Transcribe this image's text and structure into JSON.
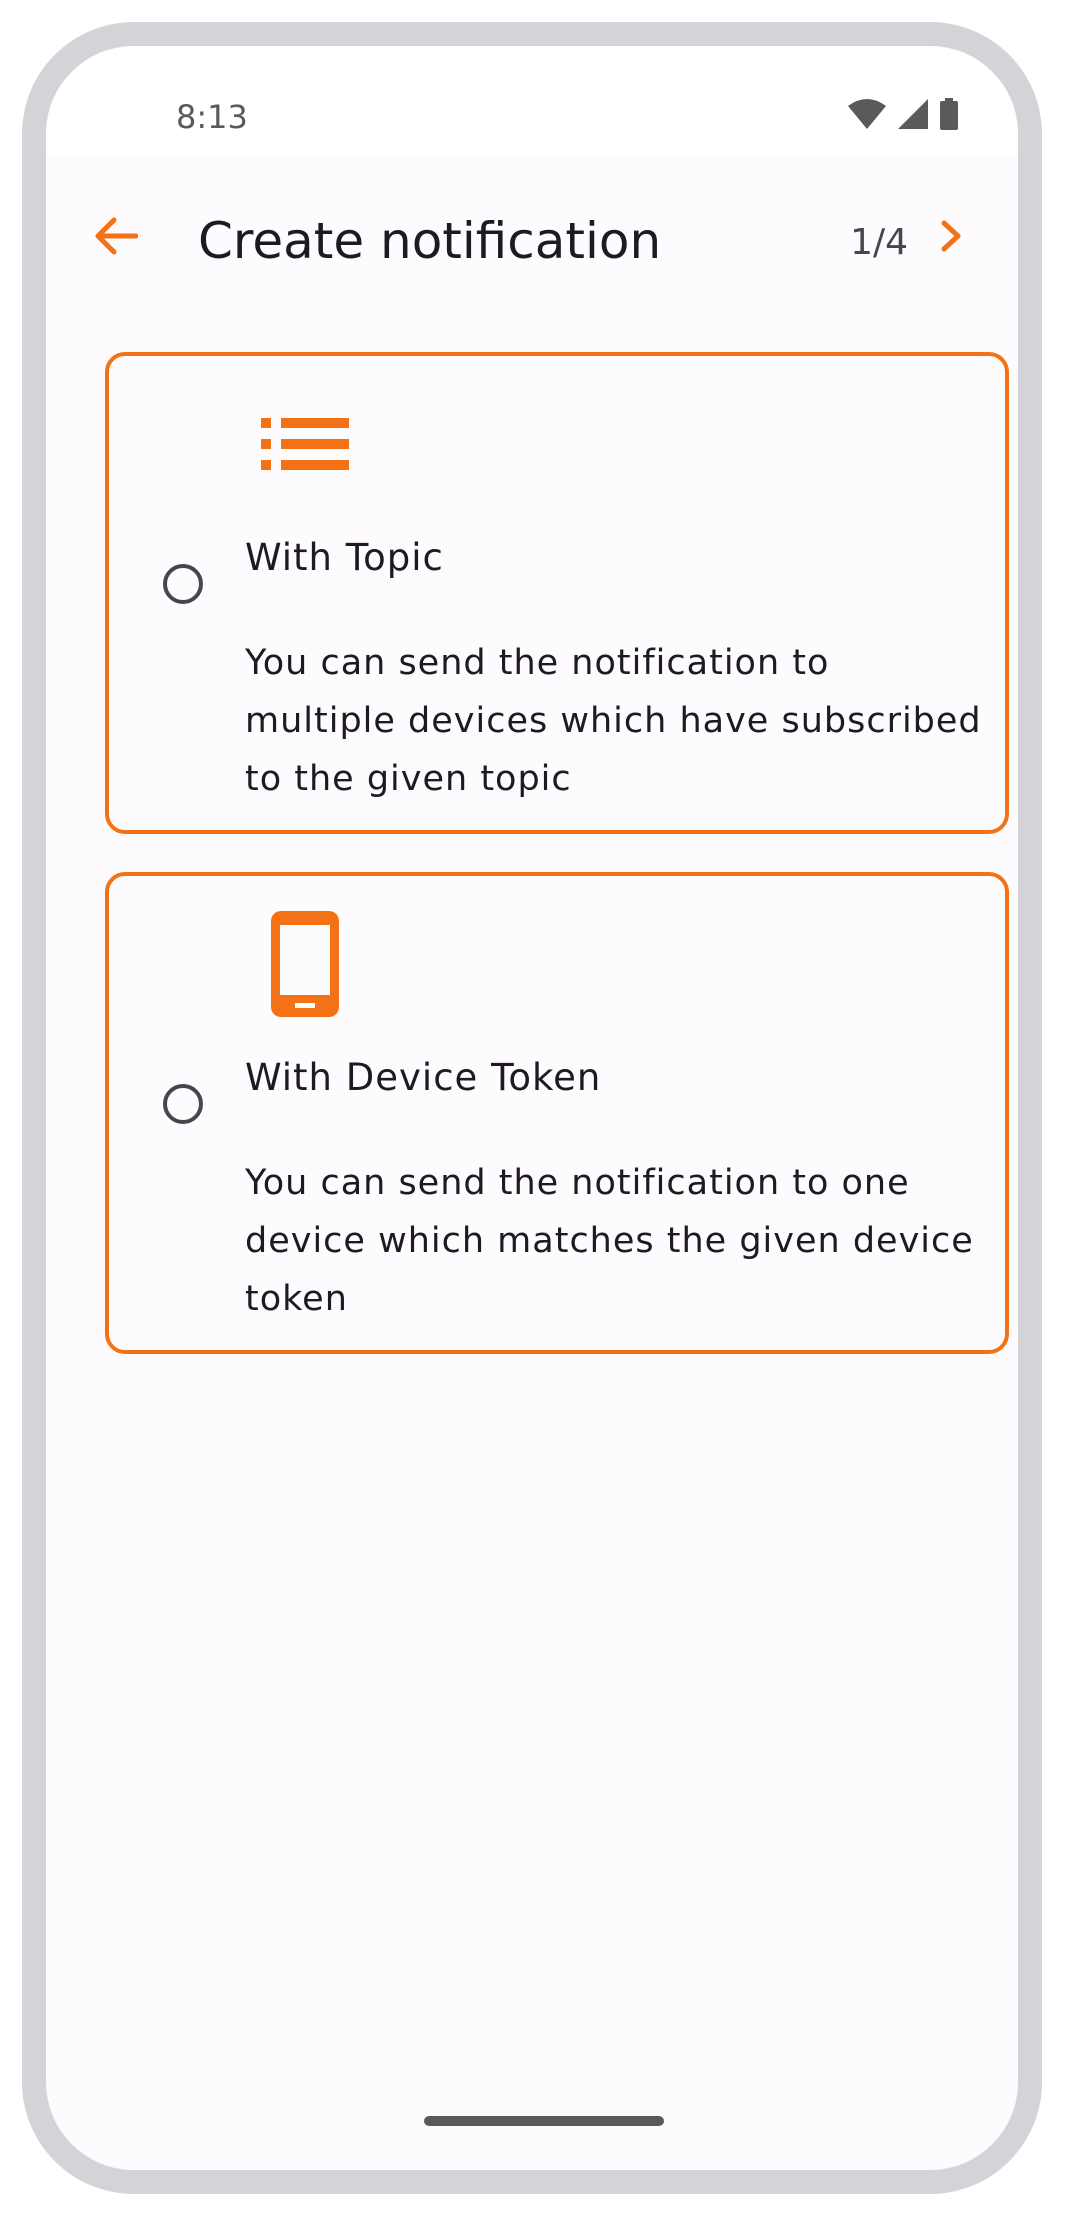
{
  "status_bar": {
    "time": "8:13",
    "icons": [
      "wifi-icon",
      "cellular-signal-icon",
      "battery-icon"
    ]
  },
  "top_bar": {
    "back_icon": "arrow-back-icon",
    "title": "Create notification",
    "page_counter": "1/4",
    "next_icon": "chevron-right-icon"
  },
  "options": [
    {
      "icon": "list-icon",
      "title": "With Topic",
      "description": "You can send the notification to multiple devices which have subscribed to the given topic",
      "selected": false
    },
    {
      "icon": "smartphone-icon",
      "title": "With Device Token",
      "description": "You can send the notification to one device which matches the given device token",
      "selected": false
    }
  ],
  "colors": {
    "accent": "#f47216",
    "background": "#fefbfe",
    "text_primary": "#1d1b20",
    "text_secondary": "#49454f",
    "frame": "#d4d4d8"
  }
}
